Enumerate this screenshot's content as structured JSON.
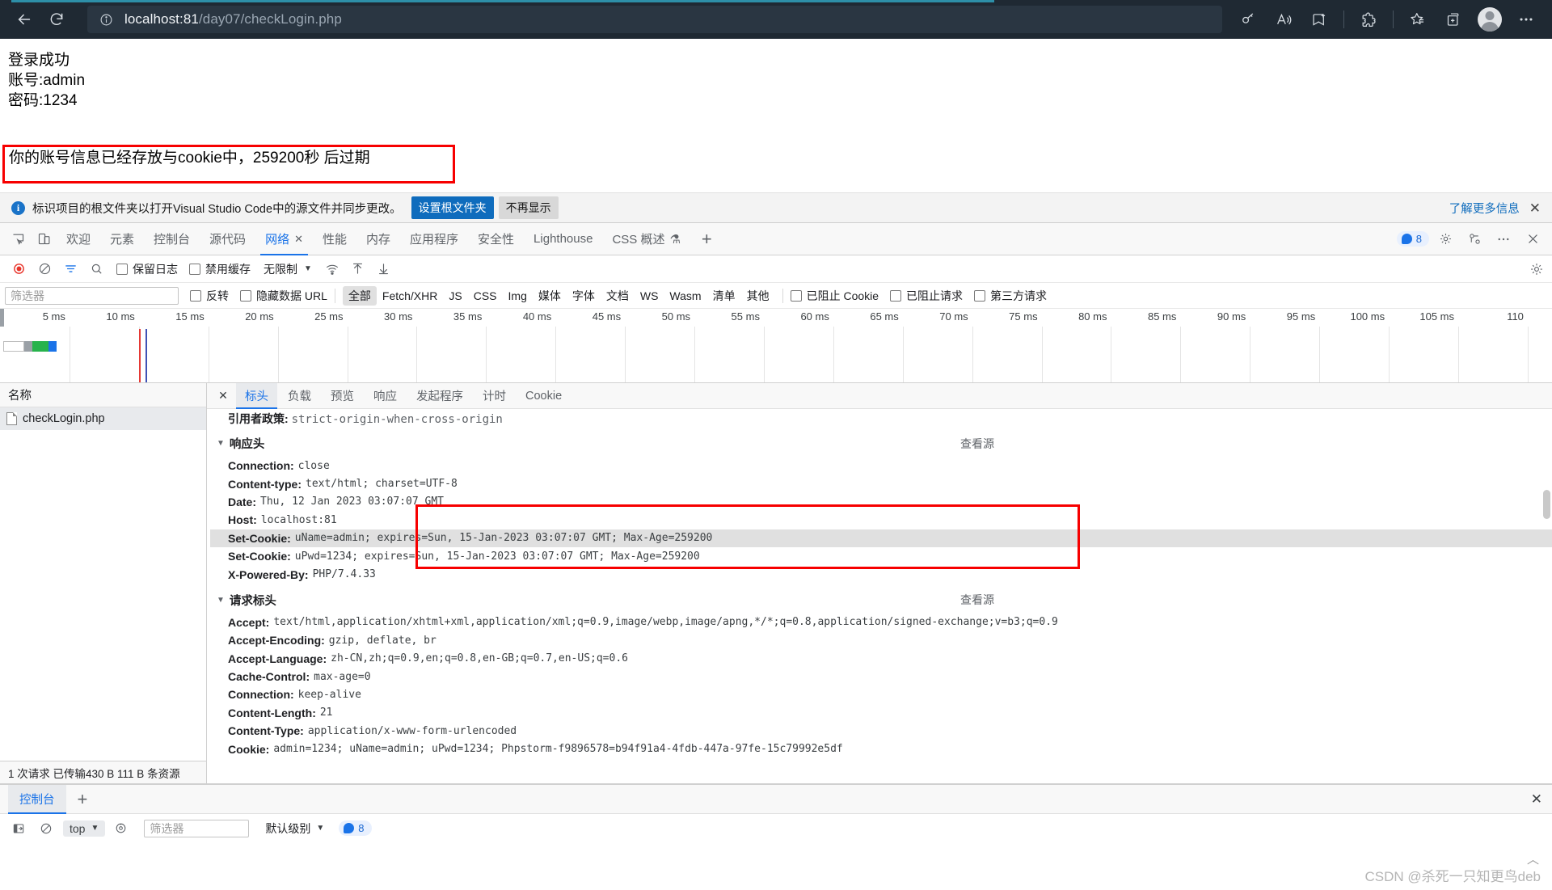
{
  "browser": {
    "back_label": "back-arrow",
    "reload_label": "reload",
    "url_host": "localhost:81",
    "url_path": "/day07/checkLogin.php",
    "icons": [
      "key-icon",
      "read-aloud-icon",
      "favorite-add-icon",
      "extensions-icon",
      "favorites-icon",
      "collections-icon",
      "profile-avatar",
      "settings-ellipsis-icon"
    ]
  },
  "page": {
    "line1": "登录成功",
    "line2": "账号:admin",
    "line3": "密码:1234",
    "cookie_notice": "你的账号信息已经存放与cookie中，259200秒 后过期"
  },
  "infobar": {
    "message": "标识项目的根文件夹以打开Visual Studio Code中的源文件并同步更改。",
    "primary_button": "设置根文件夹",
    "secondary_button": "不再显示",
    "learn_more": "了解更多信息",
    "close": "✕"
  },
  "devtools": {
    "tabs": [
      {
        "label": "欢迎",
        "active": false
      },
      {
        "label": "元素",
        "active": false
      },
      {
        "label": "控制台",
        "active": false
      },
      {
        "label": "源代码",
        "active": false
      },
      {
        "label": "网络",
        "active": true,
        "closable": true
      },
      {
        "label": "性能",
        "active": false
      },
      {
        "label": "内存",
        "active": false
      },
      {
        "label": "应用程序",
        "active": false
      },
      {
        "label": "安全性",
        "active": false
      },
      {
        "label": "Lighthouse",
        "active": false
      },
      {
        "label": "CSS 概述",
        "active": false,
        "flask": true
      }
    ],
    "add_tab": "+",
    "error_count": "8",
    "toolbar": {
      "record_icon": "record-icon",
      "clear_icon": "clear-icon",
      "filter_icon": "filter-icon",
      "search_icon": "search-icon",
      "preserve_log": "保留日志",
      "disable_cache": "禁用缓存",
      "throttle": "无限制",
      "wifi_icon": "network-conditions-icon",
      "import_icon": "import-har-icon",
      "export_icon": "export-har-icon",
      "settings_icon": "gear-icon"
    },
    "filterbar": {
      "placeholder": "筛选器",
      "invert": "反转",
      "hide_data_urls": "隐藏数据 URL",
      "types": [
        "全部",
        "Fetch/XHR",
        "JS",
        "CSS",
        "Img",
        "媒体",
        "字体",
        "文档",
        "WS",
        "Wasm",
        "清单",
        "其他"
      ],
      "selected_type": "全部",
      "blocked_cookies": "已阻止 Cookie",
      "blocked_requests": "已阻止请求",
      "third_party": "第三方请求"
    },
    "timeline": {
      "ticks": [
        "5 ms",
        "10 ms",
        "15 ms",
        "20 ms",
        "25 ms",
        "30 ms",
        "35 ms",
        "40 ms",
        "45 ms",
        "50 ms",
        "55 ms",
        "60 ms",
        "65 ms",
        "70 ms",
        "75 ms",
        "80 ms",
        "85 ms",
        "90 ms",
        "95 ms",
        "100 ms",
        "105 ms",
        "110"
      ]
    },
    "request_list": {
      "column_header": "名称",
      "rows": [
        {
          "name": "checkLogin.php",
          "selected": true
        }
      ],
      "status": "1 次请求  已传输430 B  111 B 条资源"
    },
    "detail": {
      "close": "✕",
      "tabs": [
        {
          "label": "标头",
          "active": true
        },
        {
          "label": "负载",
          "active": false
        },
        {
          "label": "预览",
          "active": false
        },
        {
          "label": "响应",
          "active": false
        },
        {
          "label": "发起程序",
          "active": false
        },
        {
          "label": "计时",
          "active": false
        },
        {
          "label": "Cookie",
          "active": false
        }
      ],
      "cut_off_row": {
        "key": "引用者政策:",
        "value": "strict-origin-when-cross-origin"
      },
      "response_section": {
        "title": "响应头",
        "view_source": "查看源",
        "rows": [
          {
            "key": "Connection:",
            "value": "close",
            "highlight": false
          },
          {
            "key": "Content-type:",
            "value": "text/html; charset=UTF-8",
            "highlight": false
          },
          {
            "key": "Date:",
            "value": "Thu, 12 Jan 2023 03:07:07 GMT",
            "highlight": false
          },
          {
            "key": "Host:",
            "value": "localhost:81",
            "highlight": false
          },
          {
            "key": "Set-Cookie:",
            "value": "uName=admin; expires=Sun, 15-Jan-2023 03:07:07 GMT; Max-Age=259200",
            "highlight": true
          },
          {
            "key": "Set-Cookie:",
            "value": "uPwd=1234; expires=Sun, 15-Jan-2023 03:07:07 GMT; Max-Age=259200",
            "highlight": false
          },
          {
            "key": "X-Powered-By:",
            "value": "PHP/7.4.33",
            "highlight": false
          }
        ]
      },
      "request_section": {
        "title": "请求标头",
        "view_source": "查看源",
        "rows": [
          {
            "key": "Accept:",
            "value": "text/html,application/xhtml+xml,application/xml;q=0.9,image/webp,image/apng,*/*;q=0.8,application/signed-exchange;v=b3;q=0.9"
          },
          {
            "key": "Accept-Encoding:",
            "value": "gzip, deflate, br"
          },
          {
            "key": "Accept-Language:",
            "value": "zh-CN,zh;q=0.9,en;q=0.8,en-GB;q=0.7,en-US;q=0.6"
          },
          {
            "key": "Cache-Control:",
            "value": "max-age=0"
          },
          {
            "key": "Connection:",
            "value": "keep-alive"
          },
          {
            "key": "Content-Length:",
            "value": "21"
          },
          {
            "key": "Content-Type:",
            "value": "application/x-www-form-urlencoded"
          },
          {
            "key": "Cookie:",
            "value": "admin=1234; uName=admin; uPwd=1234; Phpstorm-f9896578=b94f91a4-4fdb-447a-97fe-15c79992e5df"
          }
        ]
      }
    },
    "drawer": {
      "tab": "控制台",
      "add": "+",
      "close": "✕",
      "toolbar": {
        "sidebar_icon": "show-sidebar-icon",
        "clear_icon": "clear-console-icon",
        "context": "top",
        "eye_icon": "live-expression-icon",
        "filter_placeholder": "筛选器",
        "level": "默认级别",
        "issue_count": "8"
      }
    }
  },
  "watermark": "CSDN @杀死一只知更鸟deb",
  "colors": {
    "accent": "#1a73e8",
    "red_box": "#f70000",
    "chrome_bg": "#1f2933",
    "highlight_row": "#e0e0e0"
  }
}
